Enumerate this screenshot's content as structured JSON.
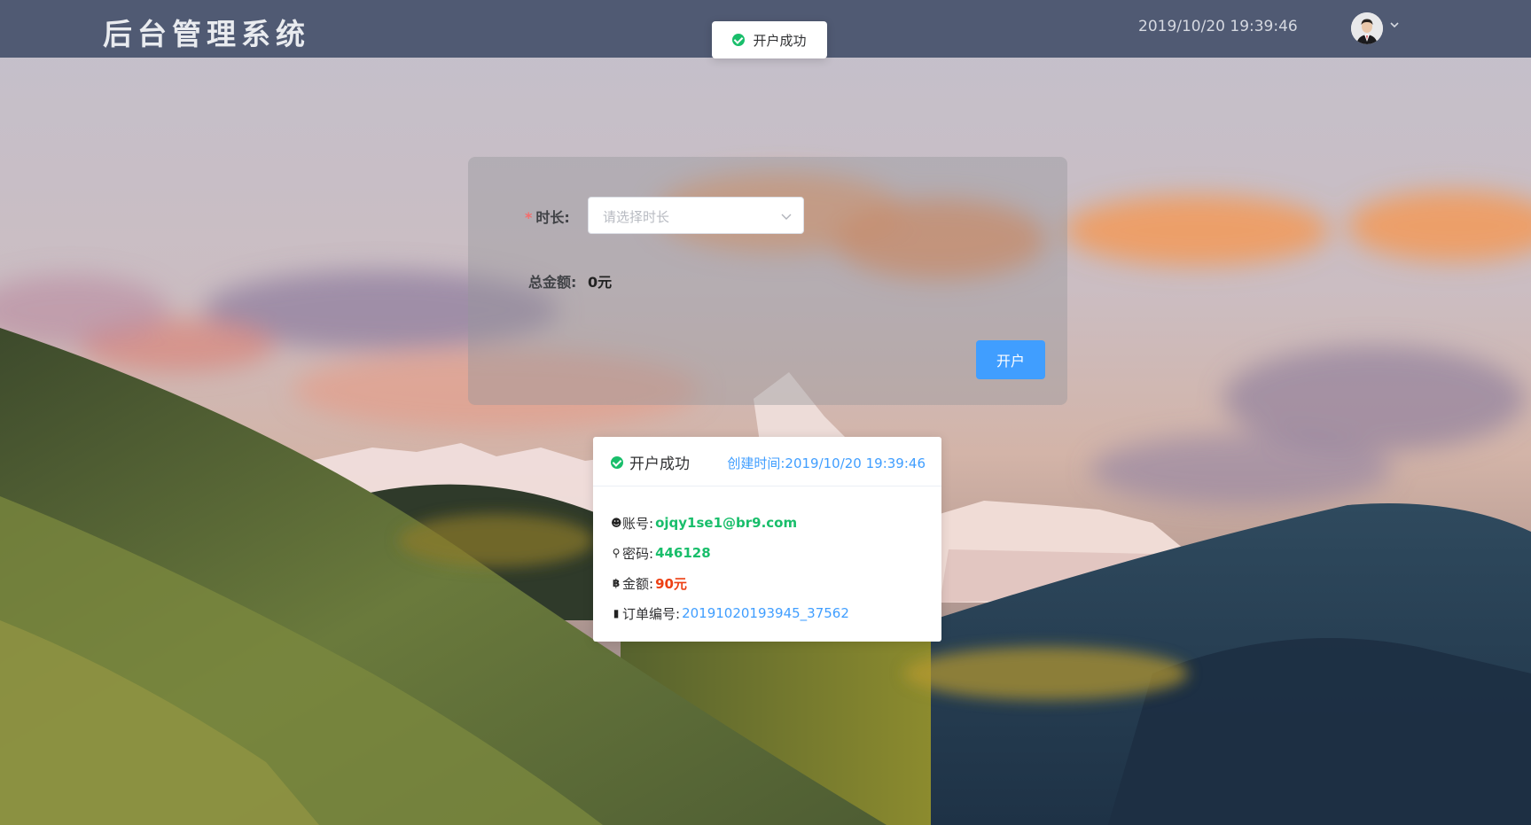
{
  "header": {
    "logo": "后台管理系统",
    "datetime": "2019/10/20 19:39:46"
  },
  "toast": {
    "message": "开户成功"
  },
  "form": {
    "duration_label": "时长:",
    "duration_required_mark": "*",
    "duration_placeholder": "请选择时长",
    "total_label": "总金额:",
    "total_value": "0元",
    "submit_label": "开户"
  },
  "result": {
    "title": "开户成功",
    "created_time": "创建时间:2019/10/20 19:39:46",
    "account_label": "账号:",
    "account_value": "ojqy1se1@br9.com",
    "password_label": "密码:",
    "password_value": "446128",
    "amount_label": "金额:",
    "amount_value": "90元",
    "order_label": "订单编号:",
    "order_value": "20191020193945_37562"
  },
  "colors": {
    "header_bg": "#505a73",
    "primary": "#409eff",
    "success": "#19be6b",
    "danger": "#ed4014"
  }
}
